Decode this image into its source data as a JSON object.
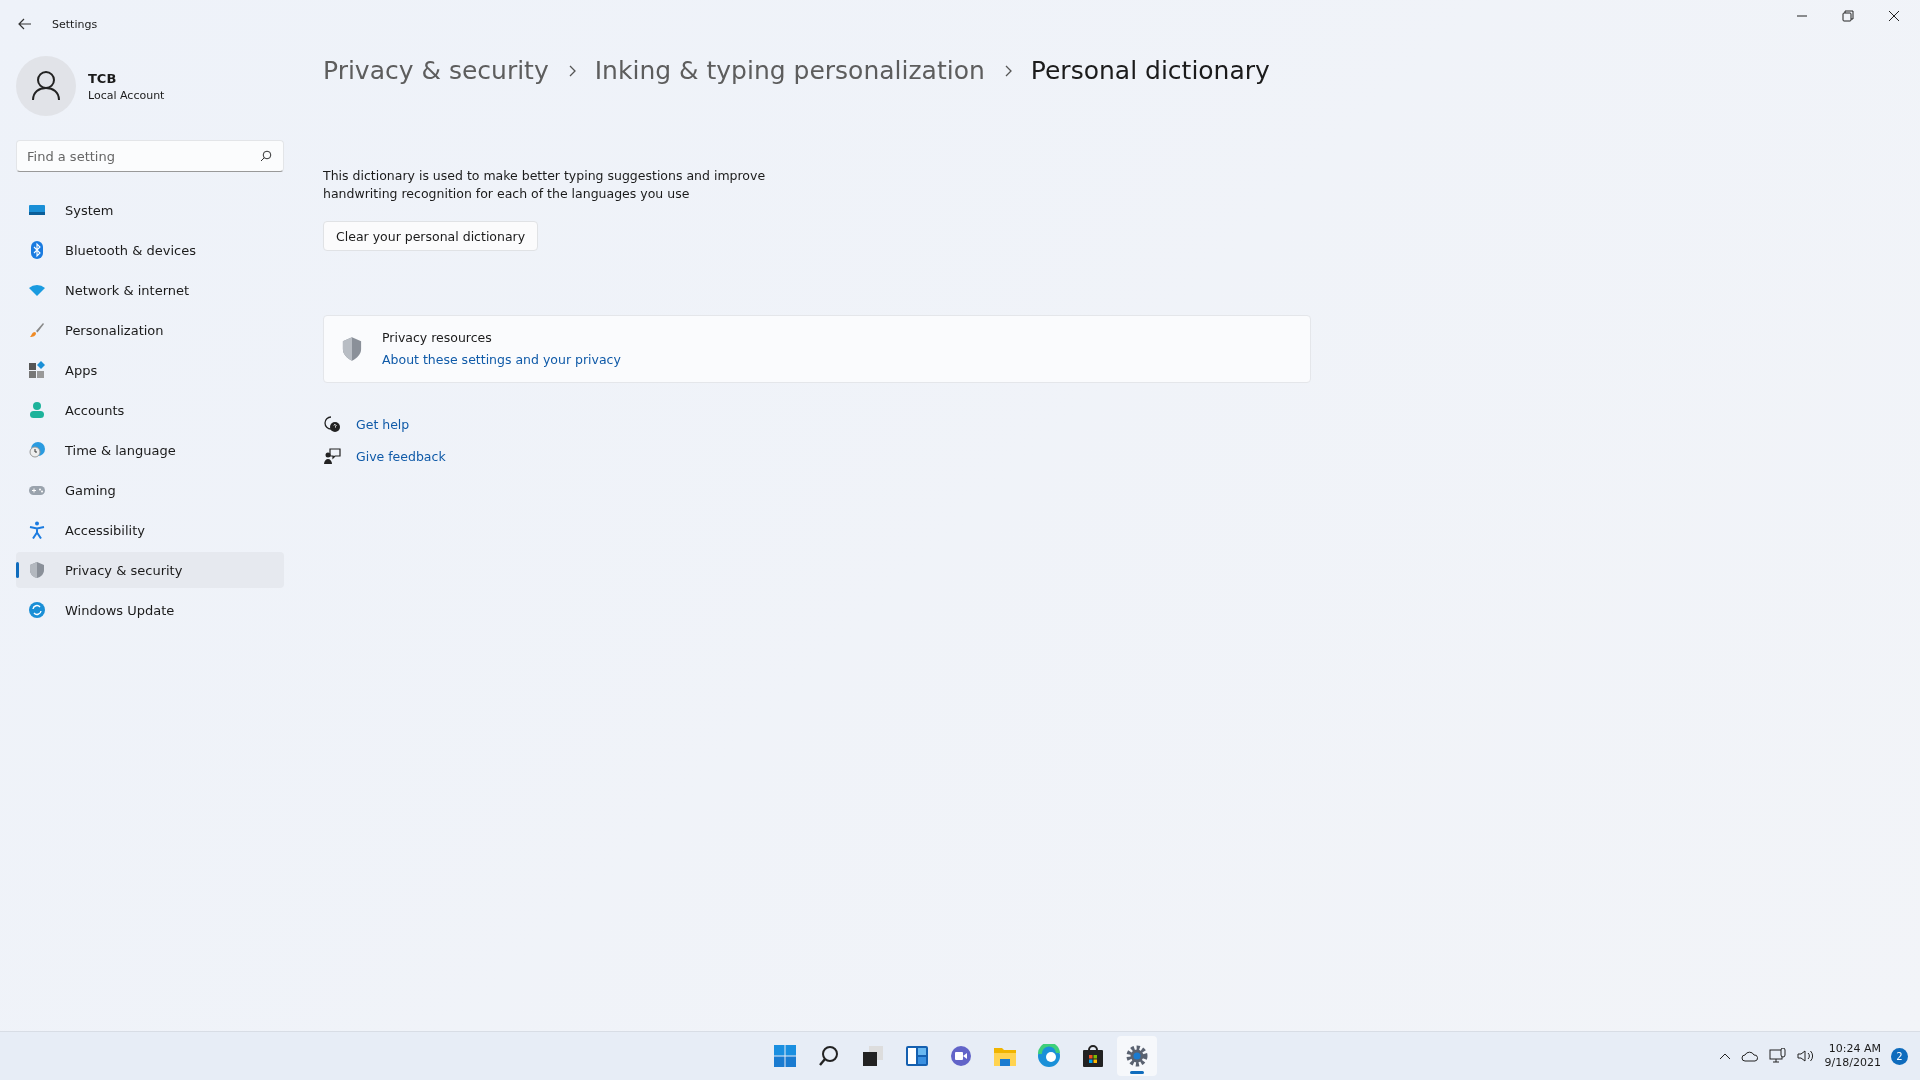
{
  "window": {
    "title": "Settings"
  },
  "profile": {
    "name": "TCB",
    "account": "Local Account"
  },
  "search": {
    "placeholder": "Find a setting"
  },
  "nav": [
    {
      "label": "System",
      "selected": false
    },
    {
      "label": "Bluetooth & devices",
      "selected": false
    },
    {
      "label": "Network & internet",
      "selected": false
    },
    {
      "label": "Personalization",
      "selected": false
    },
    {
      "label": "Apps",
      "selected": false
    },
    {
      "label": "Accounts",
      "selected": false
    },
    {
      "label": "Time & language",
      "selected": false
    },
    {
      "label": "Gaming",
      "selected": false
    },
    {
      "label": "Accessibility",
      "selected": false
    },
    {
      "label": "Privacy & security",
      "selected": true
    },
    {
      "label": "Windows Update",
      "selected": false
    }
  ],
  "breadcrumb": [
    "Privacy & security",
    "Inking & typing personalization",
    "Personal dictionary"
  ],
  "description": "This dictionary is used to make better typing suggestions and improve handwriting recognition for each of the languages you use",
  "clear_button": "Clear your personal dictionary",
  "privacy_card": {
    "title": "Privacy resources",
    "link": "About these settings and your privacy"
  },
  "help_links": [
    "Get help",
    "Give feedback"
  ],
  "taskbar": {
    "apps": [
      {
        "selected": false
      },
      {
        "selected": false
      },
      {
        "selected": false
      },
      {
        "selected": false
      },
      {
        "selected": false
      },
      {
        "selected": false
      },
      {
        "selected": false
      },
      {
        "selected": false
      },
      {
        "selected": true
      }
    ],
    "time": "10:24 AM",
    "date": "9/18/2021",
    "notifications": "2"
  }
}
